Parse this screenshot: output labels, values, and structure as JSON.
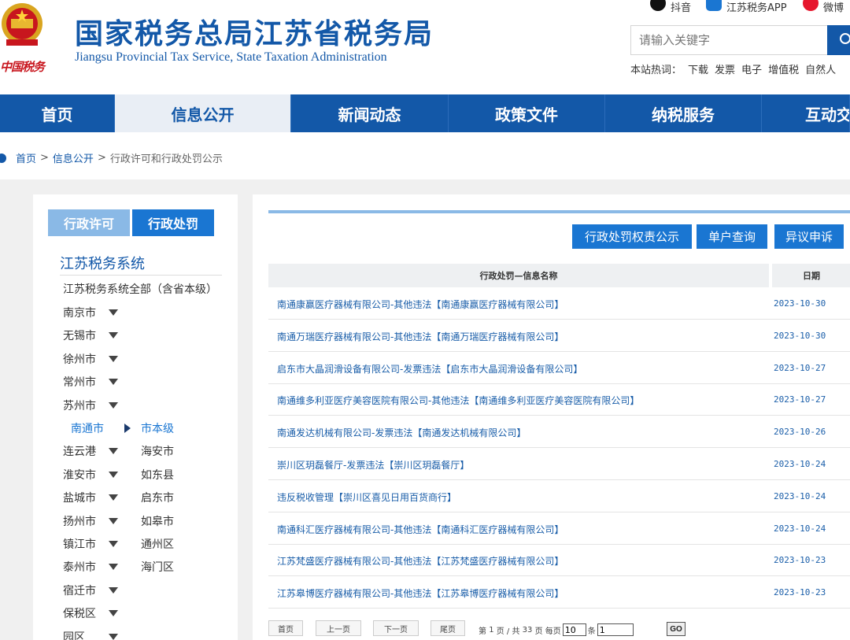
{
  "header": {
    "title": "国家税务总局江苏省税务局",
    "subtitle": "Jiangsu Provincial Tax Service, State Taxation Administration",
    "logo_text": "中国税务",
    "social": [
      {
        "label": "抖音",
        "icon": "douyin-icon"
      },
      {
        "label": "江苏税务APP",
        "icon": "app-icon"
      },
      {
        "label": "微博",
        "icon": "weibo-icon"
      }
    ],
    "search": {
      "placeholder": "请输入关键字"
    },
    "hot_label": "本站热词：",
    "hot_words": [
      "下载",
      "发票",
      "电子",
      "增值税",
      "自然人"
    ]
  },
  "nav": {
    "items": [
      {
        "label": "首页"
      },
      {
        "label": "信息公开",
        "active": true
      },
      {
        "label": "新闻动态"
      },
      {
        "label": "政策文件"
      },
      {
        "label": "纳税服务"
      },
      {
        "label": "互动交"
      }
    ]
  },
  "breadcrumb": {
    "home": "首页",
    "section": "信息公开",
    "current": "行政许可和行政处罚公示",
    "separator": ">"
  },
  "sidebar": {
    "tabs": [
      {
        "label": "行政许可"
      },
      {
        "label": "行政处罚"
      }
    ],
    "heading": "江苏税务系统",
    "all_item": "江苏税务系统全部（含省本级）",
    "cities": [
      "南京市",
      "无锡市",
      "徐州市",
      "常州市",
      "苏州市",
      "南通市",
      "连云港",
      "淮安市",
      "盐城市",
      "扬州市",
      "镇江市",
      "泰州市",
      "宿迁市",
      "保税区",
      "园区"
    ],
    "selected_city": "南通市",
    "sub_items": [
      "市本级",
      "海安市",
      "如东县",
      "启东市",
      "如皋市",
      "通州区",
      "海门区"
    ],
    "selected_sub": "市本级"
  },
  "main": {
    "buttons": [
      {
        "label": "行政处罚权责公示"
      },
      {
        "label": "单户查询"
      },
      {
        "label": "异议申诉"
      }
    ],
    "table": {
      "headers": [
        "行政处罚—信息名称",
        "日期"
      ],
      "rows": [
        {
          "name": "南通康赢医疗器械有限公司-其他违法【南通康赢医疗器械有限公司】",
          "date": "2023-10-30"
        },
        {
          "name": "南通万瑞医疗器械有限公司-其他违法【南通万瑞医疗器械有限公司】",
          "date": "2023-10-30"
        },
        {
          "name": "启东市大晶润滑设备有限公司-发票违法【启东市大晶润滑设备有限公司】",
          "date": "2023-10-27"
        },
        {
          "name": "南通维多利亚医疗美容医院有限公司-其他违法【南通维多利亚医疗美容医院有限公司】",
          "date": "2023-10-27"
        },
        {
          "name": "南通发达机械有限公司-发票违法【南通发达机械有限公司】",
          "date": "2023-10-26"
        },
        {
          "name": "崇川区玥磊餐厅-发票违法【崇川区玥磊餐厅】",
          "date": "2023-10-24"
        },
        {
          "name": "违反税收管理【崇川区喜见日用百货商行】",
          "date": "2023-10-24"
        },
        {
          "name": "南通科汇医疗器械有限公司-其他违法【南通科汇医疗器械有限公司】",
          "date": "2023-10-24"
        },
        {
          "name": "江苏梵盛医疗器械有限公司-其他违法【江苏梵盛医疗器械有限公司】",
          "date": "2023-10-23"
        },
        {
          "name": "江苏皋博医疗器械有限公司-其他违法【江苏皋博医疗器械有限公司】",
          "date": "2023-10-23"
        }
      ]
    },
    "pager": {
      "first": "首页",
      "prev": "上一页",
      "next": "下一页",
      "last": "尾页",
      "page_prefix": "第",
      "current_page": "1",
      "page_mid": "页 / 共",
      "total_pages": "33",
      "per_page_label": "页 每页",
      "per_page": "10",
      "item_unit": "条",
      "goto_value": "1",
      "go": "GO"
    }
  },
  "colors": {
    "brand": "#1358a8",
    "accent": "#1a76d2",
    "light": "#8ab9e6"
  }
}
